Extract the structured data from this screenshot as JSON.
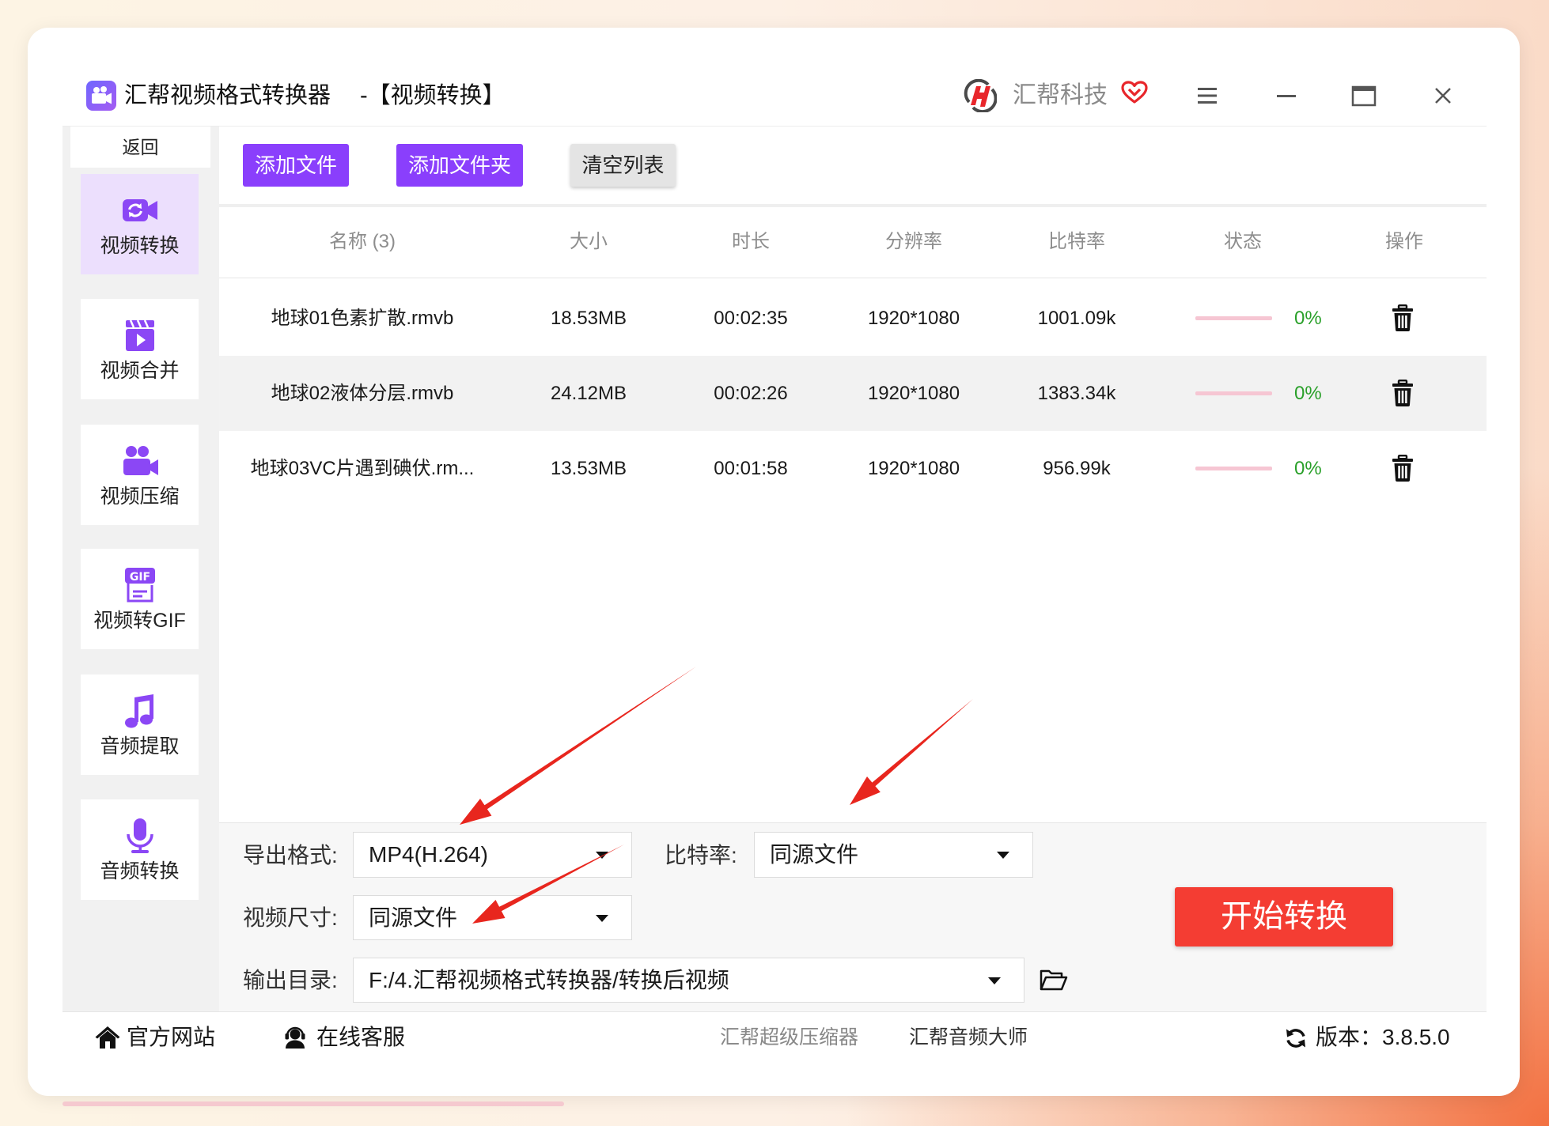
{
  "window": {
    "app_title": "汇帮视频格式转换器",
    "page_title": "-【视频转换】",
    "brand_name": "汇帮科技",
    "app_icon": "app-video-camera-icon",
    "brand_logo": "huibang-logo-icon",
    "controls": [
      "heart-vip-icon",
      "menu-icon",
      "minimize-icon",
      "maximize-icon",
      "close-icon"
    ]
  },
  "sidebar": {
    "back_label": "返回",
    "items": [
      {
        "label": "视频转换",
        "icon": "video-convert-icon",
        "active": true
      },
      {
        "label": "视频合并",
        "icon": "video-merge-icon",
        "active": false
      },
      {
        "label": "视频压缩",
        "icon": "video-compress-icon",
        "active": false
      },
      {
        "label": "视频转GIF",
        "icon": "gif-icon",
        "icon_text": "GIF",
        "active": false
      },
      {
        "label": "音频提取",
        "icon": "music-note-icon",
        "active": false
      },
      {
        "label": "音频转换",
        "icon": "microphone-icon",
        "active": false
      }
    ]
  },
  "toolbar": {
    "add_file": "添加文件",
    "add_folder": "添加文件夹",
    "clear_list": "清空列表"
  },
  "table": {
    "columns": {
      "name": "名称 (3)",
      "size": "大小",
      "duration": "时长",
      "resolution": "分辨率",
      "bitrate": "比特率",
      "status": "状态",
      "action": "操作"
    },
    "rows": [
      {
        "name": "地球01色素扩散.rmvb",
        "size": "18.53MB",
        "duration": "00:02:35",
        "resolution": "1920*1080",
        "bitrate": "1001.09k",
        "progress": 0,
        "progress_label": "0%",
        "action_icon": "trash-icon"
      },
      {
        "name": "地球02液体分层.rmvb",
        "size": "24.12MB",
        "duration": "00:02:26",
        "resolution": "1920*1080",
        "bitrate": "1383.34k",
        "progress": 0,
        "progress_label": "0%",
        "action_icon": "trash-icon"
      },
      {
        "name": "地球03VC片遇到碘伏.rm...",
        "size": "13.53MB",
        "duration": "00:01:58",
        "resolution": "1920*1080",
        "bitrate": "956.99k",
        "progress": 0,
        "progress_label": "0%",
        "action_icon": "trash-icon"
      }
    ]
  },
  "settings": {
    "format_label": "导出格式:",
    "format_value": "MP4(H.264)",
    "bitrate_label": "比特率:",
    "bitrate_value": "同源文件",
    "size_label": "视频尺寸:",
    "size_value": "同源文件",
    "output_label": "输出目录:",
    "output_value": "F:/4.汇帮视频格式转换器/转换后视频",
    "start_button": "开始转换",
    "folder_icon": "folder-open-icon"
  },
  "footer": {
    "website": "官方网站",
    "support": "在线客服",
    "link_compressor": "汇帮超级压缩器",
    "link_audio": "汇帮音频大师",
    "version": "版本：3.8.5.0"
  },
  "colors": {
    "accent": "#8a3ffc",
    "accent_light": "#ecdffd",
    "start": "#f43d33",
    "progress": "#f6c6d3",
    "status": "#2aa02a",
    "icon": "#8b47f5"
  }
}
